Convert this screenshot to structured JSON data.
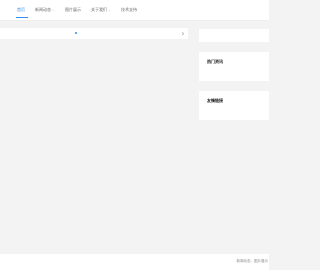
{
  "nav": {
    "items": [
      {
        "label": "首页",
        "active": true
      },
      {
        "label": "新闻动态",
        "has_dropdown": true
      },
      {
        "label": "图片展示"
      },
      {
        "label": "关于我们",
        "has_dropdown": true
      },
      {
        "label": "技术支持"
      }
    ]
  },
  "sidebar": {
    "hot_news_title": "热门资讯",
    "friend_links_title": "友情链接"
  },
  "footer": {
    "text": "新闻动态、图片展示"
  },
  "colors": {
    "accent": "#2f8ee5",
    "page_bg": "#f3f3f4"
  },
  "icons": {
    "banner_next": "chevron-right-icon",
    "dropdown": "chevron-down-icon"
  }
}
